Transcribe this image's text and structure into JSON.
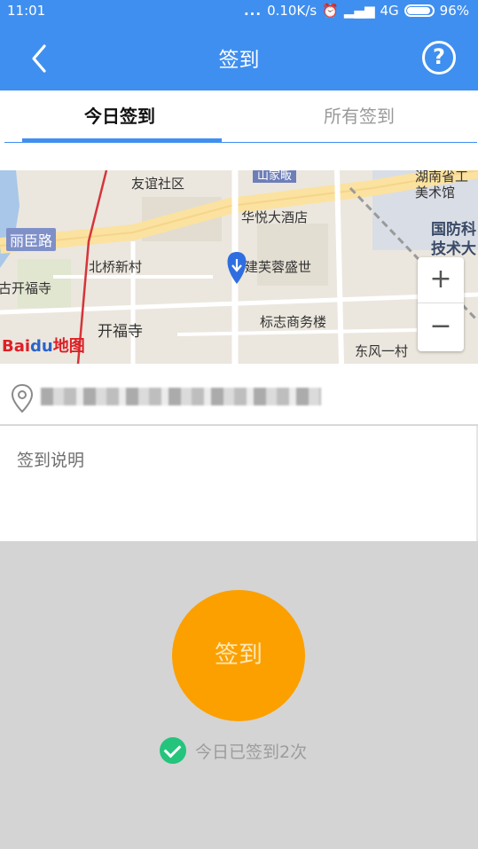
{
  "status_bar": {
    "time": "11:01",
    "dots": "...",
    "network_speed": "0.10K/s",
    "network": "4G",
    "battery": "96%"
  },
  "header": {
    "title": "签到",
    "back_icon": "chevron-left-icon",
    "help_icon": "question-circle-icon",
    "help_glyph": "?",
    "background_color": "#3f8ff0"
  },
  "tabs": [
    {
      "label": "今日签到",
      "active": true
    },
    {
      "label": "所有签到",
      "active": false
    }
  ],
  "map": {
    "labels": {
      "youyi": "友谊社区",
      "huyue": "华悦大酒店",
      "beiqiao": "北桥新村",
      "jianfu": "建芙蓉盛世",
      "gukaifu": "古开福寺",
      "kaifusi": "开福寺",
      "biaozhi": "标志商务楼",
      "dongfeng": "东风一村",
      "hunan1": "湖南省工",
      "hunan2": "美术馆",
      "guofang1": "国防科",
      "guofang2": "技术大",
      "shangjia": "山家畈",
      "road": "丽臣路"
    },
    "logo_bai": "Bai",
    "logo_du": "du",
    "logo_map": "地图",
    "zoom_in": "+",
    "zoom_out": "−"
  },
  "location": {
    "pin_icon": "map-pin-icon",
    "address_blurred": true
  },
  "note": {
    "placeholder": "签到说明"
  },
  "sign": {
    "button_label": "签到",
    "button_color": "#fca000",
    "status_icon": "check-circle-icon",
    "status_text": "今日已签到2次",
    "status_color": "#24c47c"
  }
}
